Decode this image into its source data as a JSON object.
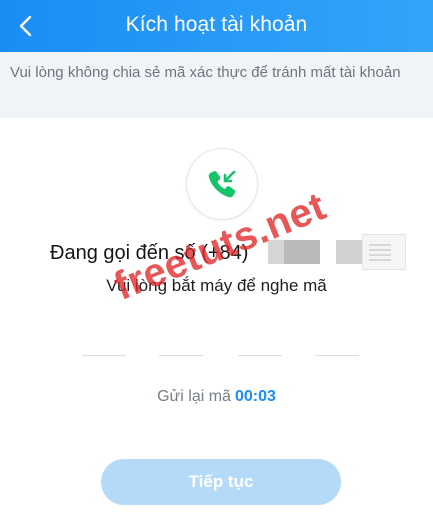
{
  "header": {
    "title": "Kích hoạt tài khoản",
    "back_icon": "chevron-left-icon"
  },
  "notice": {
    "text": "Vui lòng không chia sẻ mã xác thực để tránh mất tài khoản"
  },
  "call": {
    "icon": "incoming-call-icon",
    "calling_label": "Đang gọi đến số (+84)",
    "instruction": "Vui lòng bắt máy để nghe mã"
  },
  "otp": {
    "slots": 4
  },
  "resend": {
    "label": "Gửi lại mã",
    "timer": "00:03"
  },
  "actions": {
    "continue_label": "Tiếp tục"
  },
  "watermark": {
    "text": "freetuts.net"
  },
  "colors": {
    "header": "#1a8df5",
    "accent": "#1a8df5",
    "call_icon": "#15c36a",
    "button_disabled": "#b5daf7",
    "watermark": "#e02828"
  }
}
